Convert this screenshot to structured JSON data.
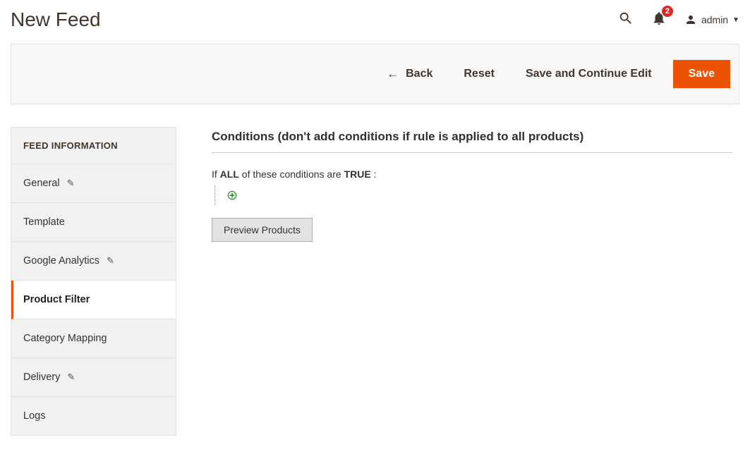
{
  "header": {
    "title": "New Feed",
    "notification_count": "2",
    "user_label": "admin"
  },
  "actions": {
    "back": "Back",
    "reset": "Reset",
    "save_continue": "Save and Continue Edit",
    "save": "Save"
  },
  "sidebar": {
    "heading": "FEED INFORMATION",
    "items": [
      {
        "label": "General",
        "editable": true
      },
      {
        "label": "Template",
        "editable": false
      },
      {
        "label": "Google Analytics",
        "editable": true
      },
      {
        "label": "Product Filter",
        "editable": false,
        "active": true
      },
      {
        "label": "Category Mapping",
        "editable": false
      },
      {
        "label": "Delivery",
        "editable": true
      },
      {
        "label": "Logs",
        "editable": false
      }
    ]
  },
  "main": {
    "section_title": "Conditions (don't add conditions if rule is applied to all products)",
    "cond_prefix": "If ",
    "cond_all": "ALL",
    "cond_mid": " of these conditions are ",
    "cond_true": "TRUE",
    "cond_suffix": " :",
    "preview_button": "Preview Products"
  }
}
